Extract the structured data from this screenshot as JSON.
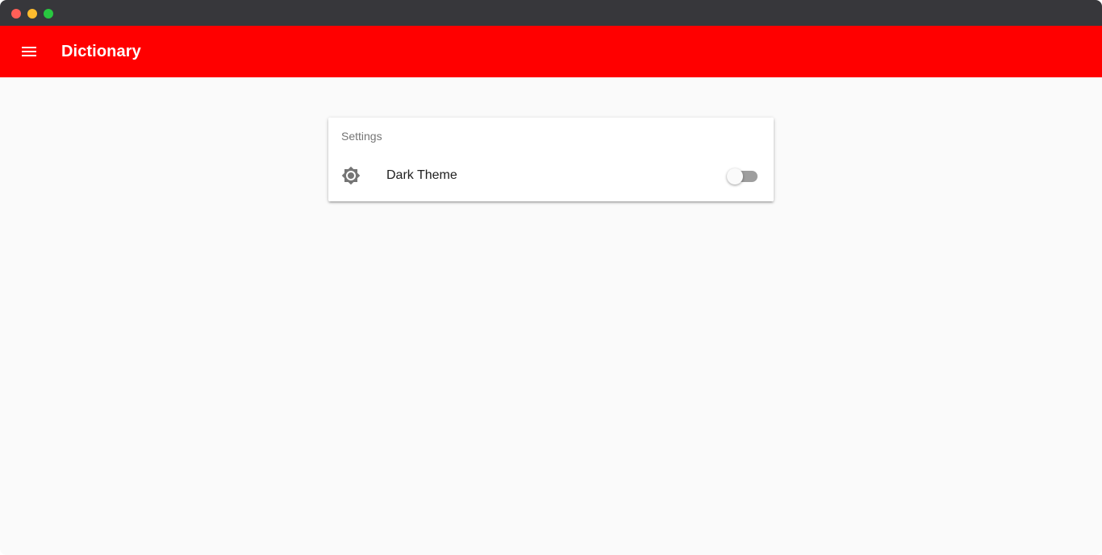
{
  "window": {
    "controls": {
      "close_color": "#ff5f57",
      "minimize_color": "#febc2e",
      "maximize_color": "#28c840"
    }
  },
  "appbar": {
    "title": "Dictionary",
    "color": "#ff0000",
    "menu_icon": "hamburger-menu-icon"
  },
  "settings": {
    "subheader": "Settings",
    "items": [
      {
        "label": "Dark Theme",
        "icon": "brightness-icon",
        "toggle_on": false
      }
    ]
  }
}
